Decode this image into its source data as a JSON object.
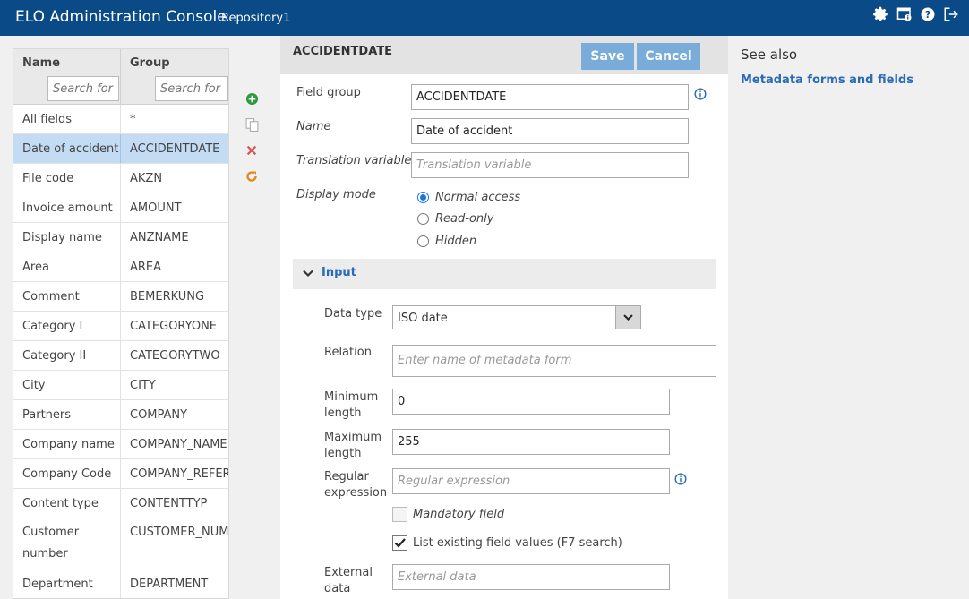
{
  "header": {
    "app_title": "ELO Administration Console",
    "repository": "Repository1",
    "icons": [
      "gear-icon",
      "monitor-info-icon",
      "help-icon",
      "logout-icon"
    ]
  },
  "table": {
    "col_name": "Name",
    "col_group": "Group",
    "search_placeholder": "Search for",
    "rows": [
      {
        "name": "All fields",
        "group": "*"
      },
      {
        "name": "Date of accident",
        "group": "ACCIDENTDATE"
      },
      {
        "name": "File code",
        "group": "AKZN"
      },
      {
        "name": "Invoice amount",
        "group": "AMOUNT"
      },
      {
        "name": "Display name",
        "group": "ANZNAME"
      },
      {
        "name": "Area",
        "group": "AREA"
      },
      {
        "name": "Comment",
        "group": "BEMERKUNG"
      },
      {
        "name": "Category I",
        "group": "CATEGORYONE"
      },
      {
        "name": "Category II",
        "group": "CATEGORYTWO"
      },
      {
        "name": "City",
        "group": "CITY"
      },
      {
        "name": "Partners",
        "group": "COMPANY"
      },
      {
        "name": "Company name",
        "group": "COMPANY_NAME"
      },
      {
        "name": "Company Code",
        "group": "COMPANY_REFER"
      },
      {
        "name": "Content type",
        "group": "CONTENTTYP"
      },
      {
        "name": "Customer number",
        "group": "CUSTOMER_NUM"
      },
      {
        "name": "Department",
        "group": "DEPARTMENT"
      }
    ]
  },
  "tools": [
    "add-icon",
    "copy-icon",
    "delete-icon",
    "refresh-icon"
  ],
  "form": {
    "title": "ACCIDENTDATE",
    "save_label": "Save",
    "cancel_label": "Cancel",
    "field_group_label": "Field group",
    "field_group_value": "ACCIDENTDATE",
    "name_label": "Name",
    "name_value": "Date of accident",
    "translation_label": "Translation variable",
    "translation_placeholder": "Translation variable",
    "display_mode_label": "Display mode",
    "display_modes": [
      "Normal access",
      "Read-only",
      "Hidden"
    ],
    "display_mode_selected": "Normal access",
    "section_input": "Input",
    "data_type_label": "Data type",
    "data_type_value": "ISO date",
    "relation_label": "Relation",
    "relation_placeholder": "Enter name of metadata form",
    "min_length_label": "Minimum length",
    "min_length_value": "0",
    "max_length_label": "Maximum length",
    "max_length_value": "255",
    "regex_label": "Regular expression",
    "regex_placeholder": "Regular expression",
    "mandatory_label": "Mandatory field",
    "mandatory_checked": false,
    "list_values_label": "List existing field values (F7 search)",
    "list_values_checked": true,
    "external_data_label": "External data",
    "external_data_placeholder": "External data"
  },
  "see_also": {
    "title": "See also",
    "link": "Metadata forms and fields"
  },
  "colors": {
    "header_bg": "#0a4a86",
    "button_bg": "#79acd9",
    "link": "#2a6ab8",
    "selected_row": "#c3dcf3"
  }
}
